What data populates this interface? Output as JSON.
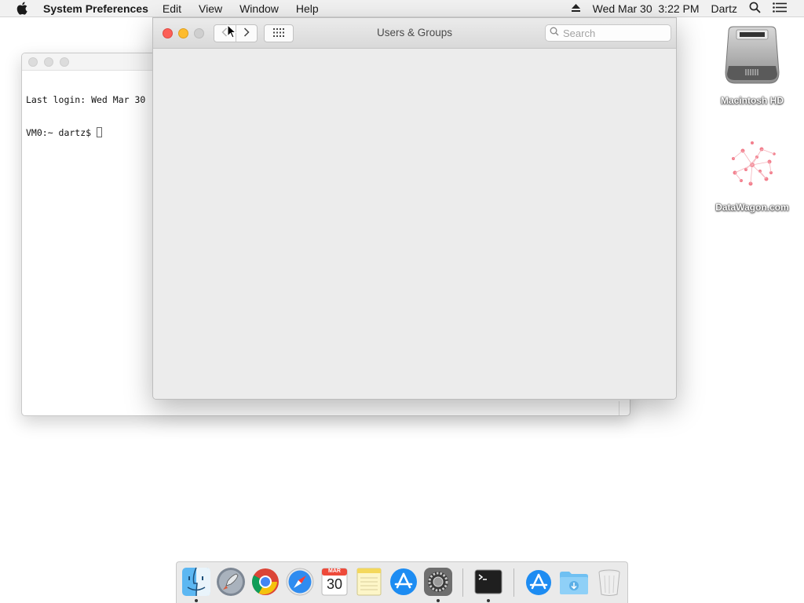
{
  "menubar": {
    "app_name": "System Preferences",
    "items": [
      "Edit",
      "View",
      "Window",
      "Help"
    ],
    "datetime": "Wed Mar 30  3:22 PM",
    "user": "Dartz"
  },
  "terminal": {
    "line1": "Last login: Wed Mar 30",
    "line2": "VM0:~ dartz$ "
  },
  "prefs_window": {
    "title": "Users & Groups",
    "search_placeholder": "Search",
    "search_value": ""
  },
  "desktop": {
    "icons": [
      {
        "label": "Macintosh HD",
        "icon": "hard-drive-icon"
      },
      {
        "label": "DataWagon.com",
        "icon": "image-file-icon"
      }
    ]
  },
  "dock": {
    "apps": [
      {
        "name": "Finder",
        "icon": "finder-icon",
        "running": true
      },
      {
        "name": "Launchpad",
        "icon": "launchpad-icon",
        "running": false
      },
      {
        "name": "Google Chrome",
        "icon": "chrome-icon",
        "running": false
      },
      {
        "name": "Safari",
        "icon": "safari-icon",
        "running": false
      },
      {
        "name": "Calendar",
        "icon": "calendar-icon",
        "running": false,
        "month": "MAR",
        "day": "30"
      },
      {
        "name": "Notes",
        "icon": "notes-icon",
        "running": false
      },
      {
        "name": "App Store",
        "icon": "app-store-icon",
        "running": false
      },
      {
        "name": "System Preferences",
        "icon": "system-preferences-icon",
        "running": true
      },
      {
        "name": "Terminal",
        "icon": "terminal-icon",
        "running": true
      },
      {
        "name": "Applications",
        "icon": "applications-folder-icon",
        "running": false
      },
      {
        "name": "Downloads",
        "icon": "downloads-folder-icon",
        "running": false
      },
      {
        "name": "Trash",
        "icon": "trash-icon",
        "running": false
      }
    ]
  },
  "colors": {
    "close": "#fc5f57",
    "minimize": "#fdbc2e",
    "window_bg": "#ececec"
  }
}
